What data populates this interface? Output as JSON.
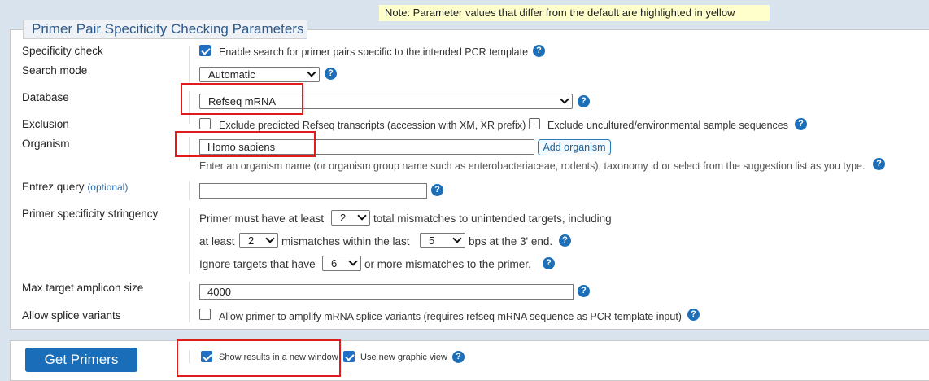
{
  "note": "Note: Parameter values that differ from the default are highlighted in yellow",
  "panel_title": "Primer Pair Specificity Checking Parameters",
  "specificity_check": {
    "label": "Specificity check",
    "checkbox_text": "Enable search for primer pairs specific to the intended PCR template",
    "checked": true
  },
  "search_mode": {
    "label": "Search mode",
    "value": "Automatic"
  },
  "database": {
    "label": "Database",
    "value": "Refseq mRNA"
  },
  "exclusion": {
    "label": "Exclusion",
    "option1": "Exclude predicted Refseq transcripts (accession with XM, XR prefix)",
    "option2": "Exclude uncultured/environmental sample sequences"
  },
  "organism": {
    "label": "Organism",
    "value": "Homo sapiens",
    "add_button": "Add organism",
    "hint": "Enter an organism name (or organism group name such as enterobacteriaceae, rodents), taxonomy id or select from the suggestion list as you type."
  },
  "entrez": {
    "label": "Entrez query",
    "optional": "(optional)",
    "value": ""
  },
  "stringency": {
    "label": "Primer specificity stringency",
    "line1_pre": "Primer must have at least",
    "line1_value": "2",
    "line1_post": "total mismatches to unintended targets, including",
    "line2_pre": "at least",
    "line2_value": "2",
    "line2_mid": "mismatches within the last",
    "line2_value2": "5",
    "line2_post": "bps at the 3' end.",
    "line3_pre": "Ignore targets that have",
    "line3_value": "6",
    "line3_post": "or more mismatches to the primer."
  },
  "amplicon": {
    "label": "Max target amplicon size",
    "value": "4000"
  },
  "splice": {
    "label": "Allow splice variants",
    "checkbox_text": "Allow primer to amplify mRNA splice variants (requires refseq mRNA sequence as PCR template input)"
  },
  "actions": {
    "get_primers": "Get Primers",
    "new_window": "Show results in a new window",
    "graphic_view": "Use new graphic view"
  },
  "help_glyph": "?",
  "colors": {
    "accent": "#1a6db8",
    "highlight": "#ffffcc",
    "annotation": "#e01b1b"
  }
}
